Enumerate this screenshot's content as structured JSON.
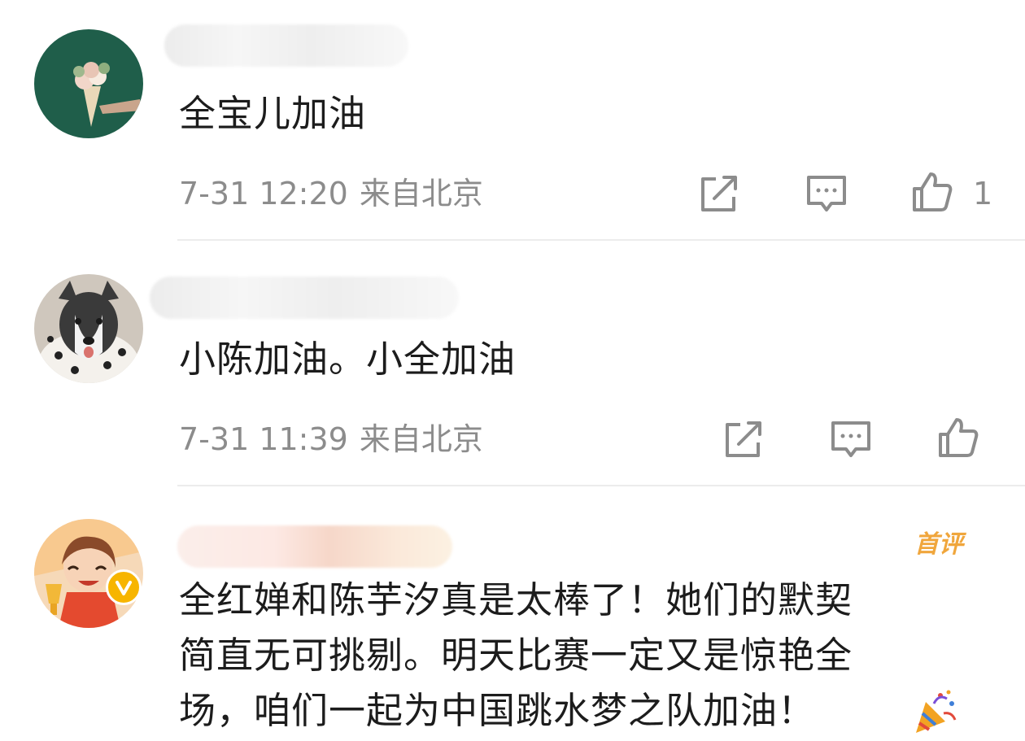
{
  "comments": [
    {
      "text": "全宝儿加油",
      "date": "7-31 12:20",
      "location": "来自北京",
      "like_count": "1"
    },
    {
      "text": "小陈加油。小全加油",
      "date": "7-31 11:39",
      "location": "来自北京",
      "like_count": ""
    },
    {
      "badge": "首评",
      "text_lines": [
        "全红婵和陈芋汐真是太棒了！她们的默契",
        "简直无可挑剔。明天比赛一定又是惊艳全",
        "场，咱们一起为中国跳水梦之队加油！"
      ],
      "emoji": "party-popper"
    }
  ],
  "colors": {
    "meta_text": "#8c8c8c",
    "body_text": "#1c1c1c",
    "badge": "#f0a63c",
    "verified_badge": "#f7b500",
    "divider": "#ececec"
  },
  "icons": [
    "share-icon",
    "reply-icon",
    "like-icon"
  ]
}
